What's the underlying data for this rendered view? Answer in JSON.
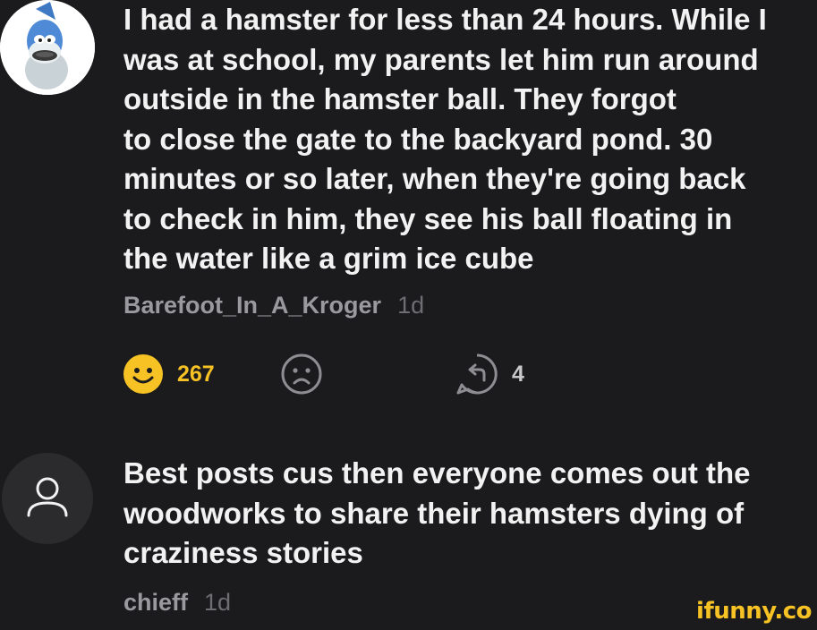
{
  "comments": [
    {
      "text": "I had a hamster for less than 24 hours. While I\nwas at school, my parents let him run around\noutside in the hamster ball. They forgot\nto close the gate to the backyard pond. 30\nminutes or so later, when they're going back\nto check in him, they see his ball floating in\nthe water like a grim ice cube",
      "username": "Barefoot_In_A_Kroger",
      "age": "1d",
      "smile_count": "267",
      "reply_count": "4"
    },
    {
      "text": "Best posts cus then everyone comes out the\nwoodworks to share their hamsters dying of\ncraziness stories",
      "username": "chieff",
      "age": "1d"
    }
  ],
  "watermark": "ifunny.co",
  "colors": {
    "background": "#1b1b1d",
    "text": "#f2f2f2",
    "meta": "#9a9a9e",
    "smile_yellow": "#f6c224",
    "icon_gray": "#8e8e92"
  },
  "icons": {
    "smile": "smile-icon",
    "unsmile": "unsmile-icon",
    "reply": "reply-icon",
    "default_avatar": "user-icon"
  }
}
